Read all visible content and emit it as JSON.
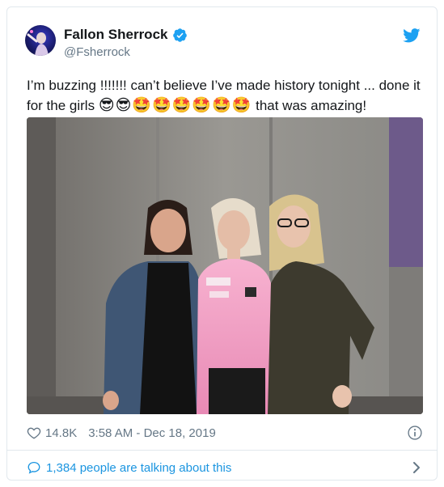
{
  "user": {
    "display_name": "Fallon Sherrock",
    "handle": "@Fsherrock",
    "verified": true
  },
  "tweet": {
    "text_main": "I’m buzzing !!!!!!! can’t believe I’ve made history tonight ... done it for the girls ",
    "emojis": "😎😎🤩🤩🤩🤩🤩🤩",
    "text_end": " that was amazing!"
  },
  "meta": {
    "likes": "14.8K",
    "timestamp": "3:58 AM - Dec 18, 2019"
  },
  "footer": {
    "conversation": "1,384 people are talking about this"
  },
  "colors": {
    "twitter_blue": "#1da1f2",
    "link_blue": "#1b95e0",
    "secondary_text": "#657786",
    "border": "#e1e8ed"
  },
  "icons": [
    "twitter-bird-icon",
    "verified-badge-icon",
    "heart-icon",
    "info-icon",
    "comment-bubble-icon",
    "chevron-right-icon"
  ]
}
